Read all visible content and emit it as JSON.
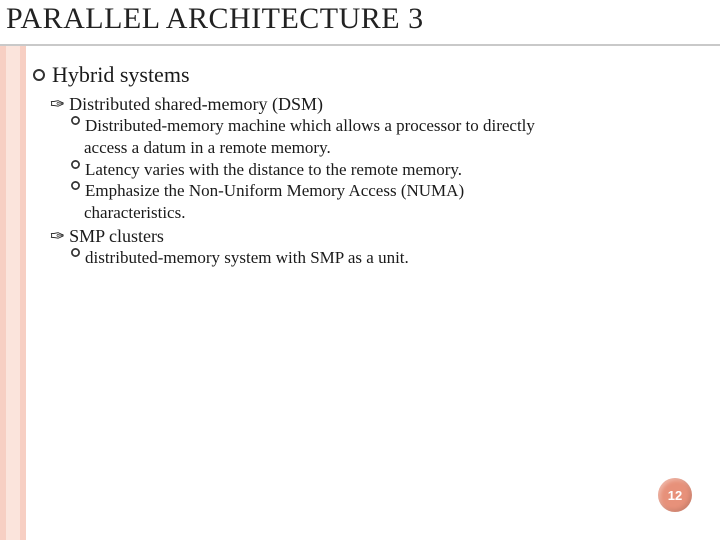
{
  "title": "PARALLEL ARCHITECTURE 3",
  "page_number": "12",
  "bullets": {
    "l1": {
      "text": "Hybrid systems"
    },
    "l2a": {
      "text": "Distributed shared-memory (DSM)"
    },
    "l3a": {
      "line1": "Distributed-memory machine which allows a processor to directly",
      "line2": "access a datum in a remote memory."
    },
    "l3b": {
      "text": "Latency varies with the distance to the remote memory."
    },
    "l3c": {
      "line1": "Emphasize the Non-Uniform Memory Access (NUMA)",
      "line2": "characteristics."
    },
    "l2b": {
      "text": "SMP clusters"
    },
    "l3d": {
      "text": "distributed-memory system with SMP as a unit."
    }
  }
}
